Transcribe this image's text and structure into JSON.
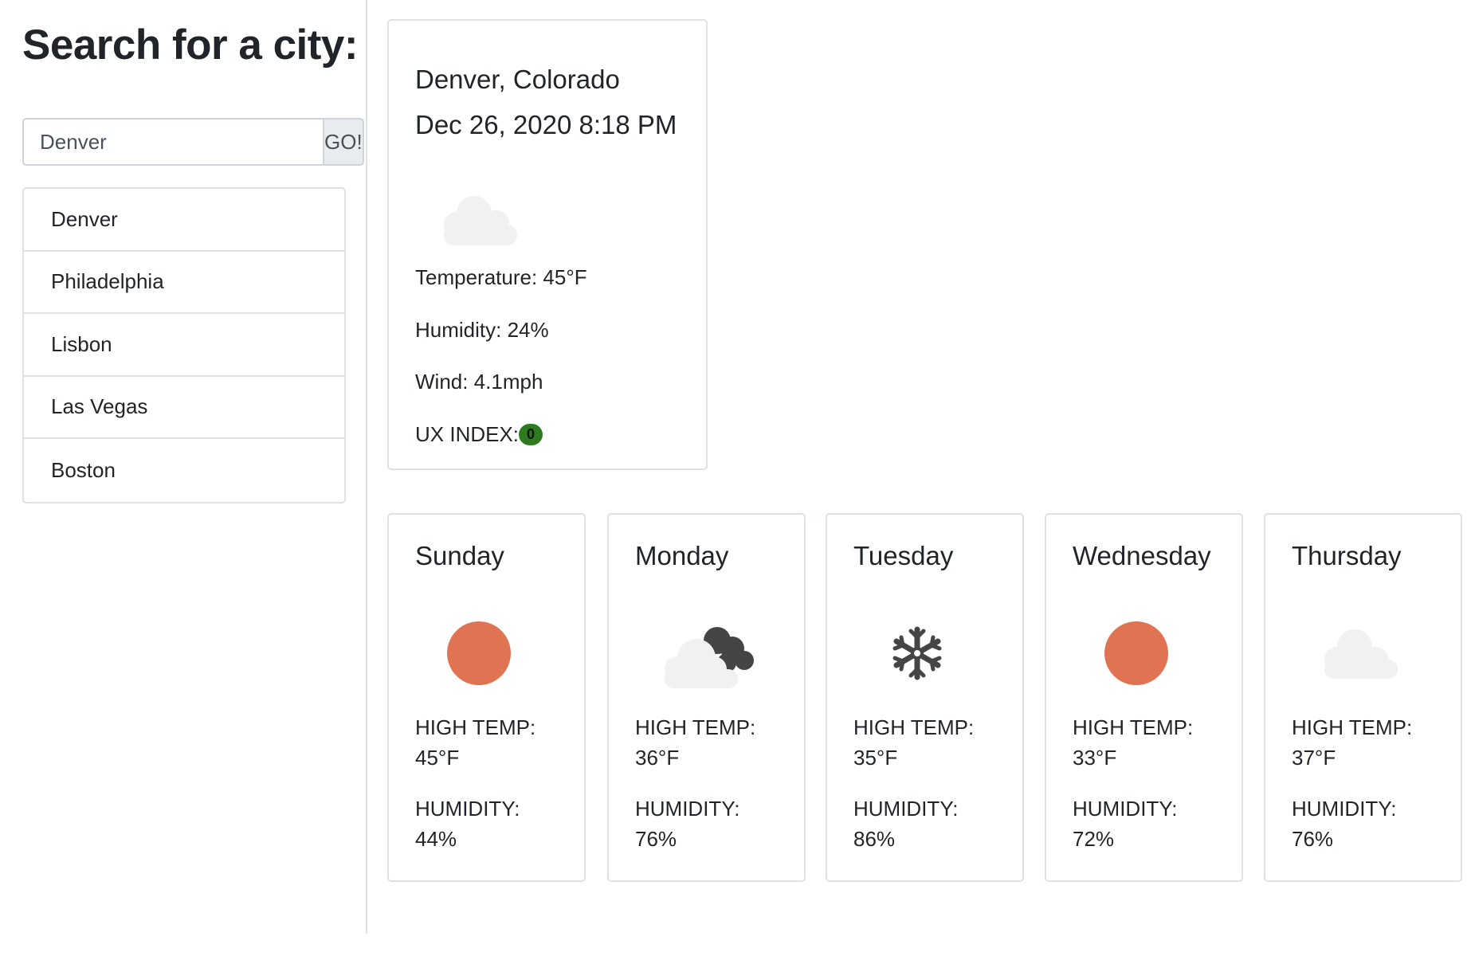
{
  "sidebar": {
    "title": "Search for a city:",
    "search_value": "Denver",
    "go_label": "GO!",
    "cities": [
      "Denver",
      "Philadelphia",
      "Lisbon",
      "Las Vegas",
      "Boston"
    ]
  },
  "current": {
    "location": "Denver, Colorado",
    "datetime": "Dec 26, 2020 8:18 PM",
    "icon": "cloud-icon",
    "temperature": "Temperature: 45°F",
    "humidity": "Humidity: 24%",
    "wind": "Wind: 4.1mph",
    "ux_label": "UX INDEX:",
    "ux_value": "0",
    "ux_color": "#2d7a1f"
  },
  "forecast_labels": {
    "high": "HIGH TEMP:",
    "humidity": "HUMIDITY:"
  },
  "forecast": [
    {
      "day": "Sunday",
      "icon": "sun-icon",
      "high": "45°F",
      "humidity": "44%"
    },
    {
      "day": "Monday",
      "icon": "cloudy-icon",
      "high": "36°F",
      "humidity": "76%"
    },
    {
      "day": "Tuesday",
      "icon": "snowflake-icon",
      "high": "35°F",
      "humidity": "86%"
    },
    {
      "day": "Wednesday",
      "icon": "sun-icon",
      "high": "33°F",
      "humidity": "72%"
    },
    {
      "day": "Thursday",
      "icon": "cloud-icon",
      "high": "37°F",
      "humidity": "76%"
    }
  ],
  "colors": {
    "sun": "#e07352",
    "cloud_light": "#f1f1f1",
    "cloud_dark": "#454545"
  }
}
